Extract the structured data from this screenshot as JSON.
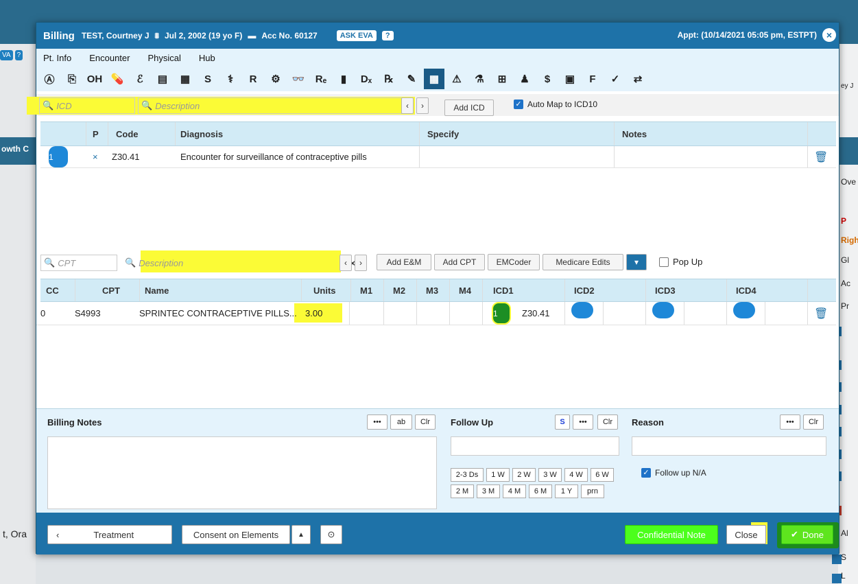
{
  "background": {
    "left_eva_labels": [
      "VA",
      "?"
    ],
    "left_bar_text": "owth C",
    "left_bottom_text": "t, Ora",
    "right_texts": [
      "ey J",
      "Ove",
      "P",
      "Righ",
      "Gl",
      "Ac",
      "Pr",
      "Al",
      "S",
      "L"
    ]
  },
  "titlebar": {
    "title": "Billing",
    "patient": "TEST, Courtney J",
    "dob": "Jul 2, 2002 (19 yo F)",
    "account": "Acc No. 60127",
    "ask_eva": "ASK EVA",
    "help": "?",
    "appt": "Appt: (10/14/2021 05:05 pm, ESTPT)",
    "close": "×"
  },
  "menu": [
    "Pt. Info",
    "Encounter",
    "Physical",
    "Hub"
  ],
  "toolbar_icons": [
    {
      "name": "a-circle-icon",
      "glyph": "Ⓐ"
    },
    {
      "name": "copy-icon",
      "glyph": "⎘"
    },
    {
      "name": "oh-icon",
      "glyph": "OH"
    },
    {
      "name": "pill-icon",
      "glyph": "💊"
    },
    {
      "name": "allergy-icon",
      "glyph": "ℰ"
    },
    {
      "name": "form-icon",
      "glyph": "▤"
    },
    {
      "name": "building-icon",
      "glyph": "▦"
    },
    {
      "name": "s-icon",
      "glyph": "S"
    },
    {
      "name": "procedure-icon",
      "glyph": "⚕"
    },
    {
      "name": "r-icon",
      "glyph": "R"
    },
    {
      "name": "vitals-icon",
      "glyph": "⚙"
    },
    {
      "name": "vision-icon",
      "glyph": "👓"
    },
    {
      "name": "re-icon",
      "glyph": "Rₑ"
    },
    {
      "name": "jar-icon",
      "glyph": "▮"
    },
    {
      "name": "dx-icon",
      "glyph": "Dₓ"
    },
    {
      "name": "rx-icon",
      "glyph": "℞"
    },
    {
      "name": "lab-draw-icon",
      "glyph": "✎"
    },
    {
      "name": "billing-grid-icon",
      "glyph": "▦",
      "active": true
    },
    {
      "name": "alert-doc-icon",
      "glyph": "⚠"
    },
    {
      "name": "flask-icon",
      "glyph": "⚗"
    },
    {
      "name": "plus-box-icon",
      "glyph": "⊞"
    },
    {
      "name": "person-icon",
      "glyph": "♟"
    },
    {
      "name": "money-icon",
      "glyph": "$"
    },
    {
      "name": "report-icon",
      "glyph": "▣"
    },
    {
      "name": "flowsheet-icon",
      "glyph": "F"
    },
    {
      "name": "tag-icon",
      "glyph": "✓"
    },
    {
      "name": "compare-icon",
      "glyph": "⇄"
    }
  ],
  "icd": {
    "code_placeholder": "ICD",
    "desc_placeholder": "Description",
    "clear": "×",
    "prev": "‹",
    "next": "›",
    "add_button": "Add ICD",
    "auto_map_label": "Auto Map to ICD10",
    "auto_map_checked": true,
    "columns": [
      "P",
      "Code",
      "Diagnosis",
      "Specify",
      "Notes"
    ],
    "rows": [
      {
        "index": "1",
        "p": "×",
        "code": "Z30.41",
        "diagnosis": "Encounter for surveillance of contraceptive pills",
        "specify": "",
        "notes": ""
      }
    ]
  },
  "cpt": {
    "code_placeholder": "CPT",
    "desc_placeholder": "Description",
    "clear": "×",
    "prev": "‹",
    "next": "›",
    "buttons": [
      "Add E&M",
      "Add CPT",
      "EMCoder",
      "Medicare Edits"
    ],
    "popup_label": "Pop Up",
    "columns": [
      "CC",
      "CPT",
      "Name",
      "Units",
      "M1",
      "M2",
      "M3",
      "M4",
      "ICD1",
      "ICD2",
      "ICD3",
      "ICD4"
    ],
    "rows": [
      {
        "cc": "0",
        "cpt": "S4993",
        "name": "SPRINTEC CONTRACEPTIVE PILLS...",
        "units": "3.00",
        "icd1_index": "1",
        "icd1_code": "Z30.41"
      }
    ]
  },
  "billing_notes": {
    "label": "Billing Notes",
    "btn_more": "•••",
    "btn_spell": "ab",
    "btn_clear": "Clr"
  },
  "follow_up": {
    "label": "Follow Up",
    "btn_s": "S",
    "btn_more": "•••",
    "btn_clear": "Clr",
    "options_row1": [
      "2-3 Ds",
      "1 W",
      "2 W",
      "3 W",
      "4 W",
      "6 W"
    ],
    "options_row2": [
      "2 M",
      "3 M",
      "4 M",
      "6 M",
      "1 Y",
      "prn"
    ]
  },
  "reason": {
    "label": "Reason",
    "btn_more": "•••",
    "btn_clear": "Clr",
    "na_label": "Follow up N/A",
    "na_checked": true
  },
  "footer": {
    "back": "‹",
    "treatment": "Treatment",
    "consent": "Consent on Elements",
    "up": "▲",
    "clock": "⊙",
    "confidential": "Confidential Note",
    "close": "Close",
    "done": "Done",
    "done_check": "✔"
  }
}
